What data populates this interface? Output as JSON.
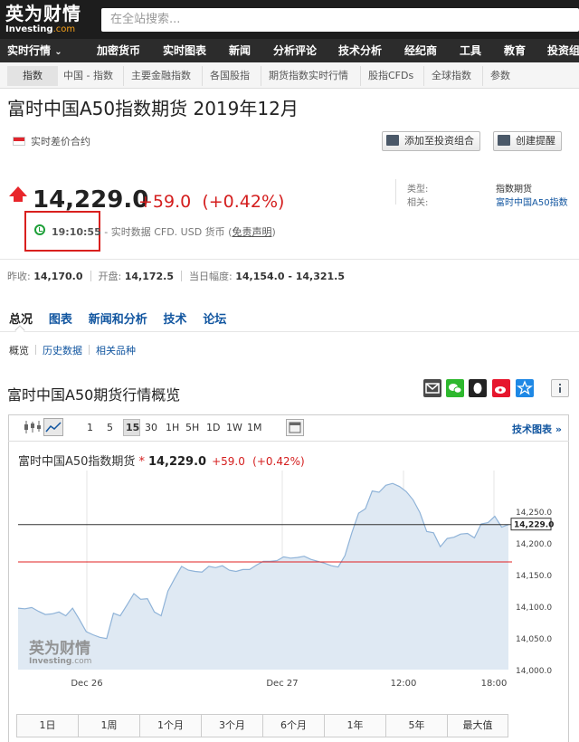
{
  "header": {
    "logo_main": "英为财情",
    "logo_sub_a": "Investing",
    "logo_sub_b": ".com",
    "search_placeholder": "在全站搜索..."
  },
  "nav": {
    "items": [
      "实时行情",
      "加密货币",
      "实时图表",
      "新闻",
      "分析评论",
      "技术分析",
      "经纪商",
      "工具",
      "教育",
      "投资组"
    ],
    "dropdown_caret": "⌄"
  },
  "subnav": {
    "items": [
      "指数",
      "中国 - 指数",
      "主要金融指数",
      "各国股指",
      "期货指数实时行情",
      "股指CFDs",
      "全球指数",
      "参数"
    ]
  },
  "instrument": {
    "title": "富时中国A50指数期货 2019年12月",
    "contract_type": "实时差价合约",
    "add_portfolio": "添加至投资组合",
    "create_alert": "创建提醒",
    "price": "14,229.0",
    "change": "+59.0",
    "change_pct": "(+0.42%)",
    "time": "19:10:55",
    "time_desc": " - 实时数据 CFD. USD 货币 (",
    "disclaimer": "免责声明",
    "time_close": ")",
    "type_label": "类型:",
    "type_value": "指数期货",
    "related_label": "相关:",
    "related_value": "富时中国A50指数",
    "prev_close_label": "昨收:",
    "prev_close": "14,170.0",
    "open_label": "开盘:",
    "open": "14,172.5",
    "range_label": "当日幅度:",
    "range": "14,154.0 - 14,321.5"
  },
  "tabs": [
    "总况",
    "图表",
    "新闻和分析",
    "技术",
    "论坛"
  ],
  "subtabs": [
    "概览",
    "历史数据",
    "相关品种"
  ],
  "section_title": "富时中国A50期货行情概览",
  "chart_toolbar": {
    "intervals": [
      "1",
      "5",
      "15",
      "30",
      "1H",
      "5H",
      "1D",
      "1W",
      "1M"
    ],
    "active_interval": "15",
    "tech_chart": "技术图表 »"
  },
  "chart_header": {
    "name": "富时中国A50指数期货",
    "star": "*",
    "price": "14,229.0",
    "change": "+59.0",
    "change_pct": "(+0.42%)"
  },
  "periods": [
    "1日",
    "1周",
    "1个月",
    "3个月",
    "6个月",
    "1年",
    "5年",
    "最大值"
  ],
  "colors": {
    "up_red": "#d41e1e",
    "link_blue": "#1256a0",
    "chart_fill": "#dfe9f3",
    "chart_line": "#8fb3d8",
    "prev_close_line": "#e02020"
  },
  "chart_data": {
    "type": "area",
    "x_ticks": [
      "Dec 26",
      "Dec 27",
      "12:00",
      "18:00"
    ],
    "y_ticks": [
      14000,
      14050,
      14100,
      14150,
      14200,
      14250
    ],
    "y_tick_labels": [
      "14,000.0",
      "14,050.0",
      "14,100.0",
      "14,150.0",
      "14,200.0",
      "14,250.0"
    ],
    "ylim": [
      14000,
      14300
    ],
    "last_price": 14229.0,
    "last_price_label": "14,229.0",
    "prev_close": 14170.0,
    "values": [
      14097,
      14096,
      14098,
      14092,
      14087,
      14088,
      14091,
      14085,
      14097,
      14079,
      14060,
      14055,
      14051,
      14049,
      14089,
      14085,
      14102,
      14120,
      14111,
      14112,
      14091,
      14085,
      14124,
      14144,
      14163,
      14157,
      14155,
      14154,
      14163,
      14161,
      14164,
      14157,
      14155,
      14158,
      14158,
      14165,
      14171,
      14171,
      14172,
      14178,
      14176,
      14177,
      14179,
      14174,
      14171,
      14168,
      14164,
      14162,
      14180,
      14216,
      14247,
      14254,
      14282,
      14280,
      14291,
      14294,
      14289,
      14281,
      14268,
      14248,
      14218,
      14216,
      14194,
      14207,
      14209,
      14214,
      14215,
      14208,
      14230,
      14232,
      14242,
      14225,
      14229
    ]
  }
}
